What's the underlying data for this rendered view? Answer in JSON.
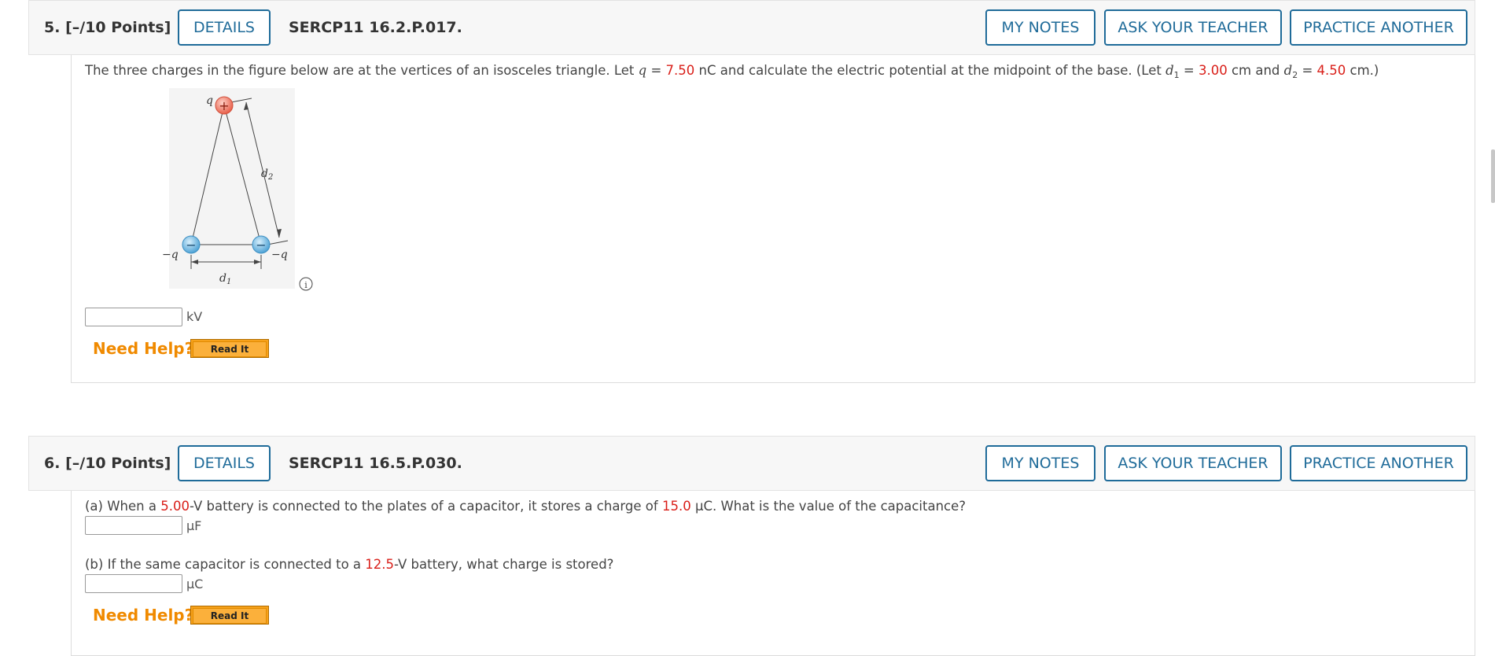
{
  "questions": [
    {
      "number": "5.",
      "points": "[–/10 Points]",
      "details_label": "DETAILS",
      "code": "SERCP11 16.2.P.017.",
      "my_notes_label": "MY NOTES",
      "ask_teacher_label": "ASK YOUR TEACHER",
      "practice_label": "PRACTICE ANOTHER",
      "text": {
        "t1": "The three charges in the figure below are at the vertices of an isosceles triangle. Let ",
        "q_var": "q",
        "t2": " = ",
        "q_val": "7.50",
        "t3": " nC and calculate the electric potential at the midpoint of the base. (Let ",
        "d1_var": "d",
        "d1_sub": "1",
        "t4": " = ",
        "d1_val": "3.00",
        "t5": " cm and ",
        "d2_var": "d",
        "d2_sub": "2",
        "t6": " = ",
        "d2_val": "4.50",
        "t7": " cm.)"
      },
      "figure": {
        "top_label": "q",
        "top_sign": "+",
        "left_label": "−q",
        "left_sign": "−",
        "right_label": "−q",
        "right_sign": "−",
        "d1_label": "d",
        "d1_sub": "1",
        "d2_label": "d",
        "d2_sub": "2"
      },
      "info_icon": "info-icon",
      "answer_unit": "kV",
      "need_help": "Need Help?",
      "read_it": "Read It"
    },
    {
      "number": "6.",
      "points": "[–/10 Points]",
      "details_label": "DETAILS",
      "code": "SERCP11 16.5.P.030.",
      "my_notes_label": "MY NOTES",
      "ask_teacher_label": "ASK YOUR TEACHER",
      "practice_label": "PRACTICE ANOTHER",
      "part_a": {
        "t1": "(a) When a ",
        "v": "5.00",
        "t2": "-V battery is connected to the plates of a capacitor, it stores a charge of ",
        "q": "15.0",
        "t3": " μC. What is the value of the capacitance?",
        "unit": "μF"
      },
      "part_b": {
        "t1": "(b) If the same capacitor is connected to a ",
        "v": "12.5",
        "t2": "-V battery, what charge is stored?",
        "unit": "μC"
      },
      "need_help": "Need Help?",
      "read_it": "Read It"
    }
  ],
  "colors": {
    "accent_blue": "#1f6b99",
    "given_value_red": "#d91e18",
    "need_help_orange": "#f08a00",
    "read_it_button": "#fbb03b"
  }
}
